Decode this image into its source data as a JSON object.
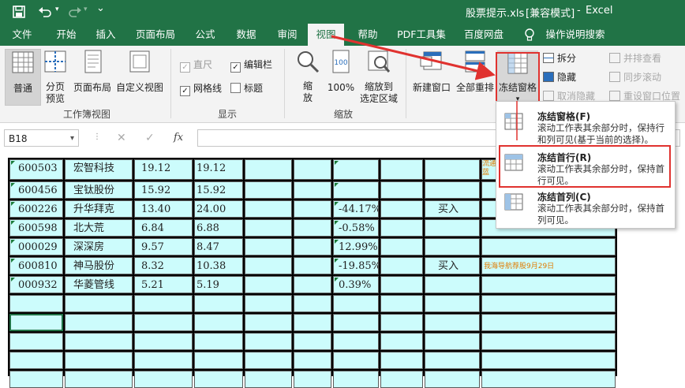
{
  "titlebar": {
    "filename": "股票提示.xls",
    "mode": "[兼容模式]",
    "separator": "-",
    "app": "Excel"
  },
  "tabs": [
    "文件",
    "开始",
    "插入",
    "页面布局",
    "公式",
    "数据",
    "审阅",
    "视图",
    "帮助",
    "PDF工具集",
    "百度网盘",
    "操作说明搜索"
  ],
  "active_tab": "视图",
  "ribbon": {
    "workbook_views": {
      "normal": "普通",
      "page_break": "分页\n预览",
      "page_layout": "页面布局",
      "custom": "自定义视图",
      "group": "工作簿视图"
    },
    "show": {
      "ruler": "直尺",
      "formula_bar": "编辑栏",
      "gridlines": "网格线",
      "headings": "标题",
      "group": "显示"
    },
    "zoom": {
      "zoom": "缩\n放",
      "zoom100": "100%",
      "zoom_sel": "缩放到\n选定区域",
      "group": "缩放"
    },
    "window": {
      "new_window": "新建窗口",
      "arrange_all": "全部重排",
      "freeze": "冻结窗格",
      "split": "拆分",
      "hide": "隐藏",
      "unhide": "取消隐藏",
      "side_by_side": "并排查看",
      "sync_scroll": "同步滚动",
      "reset_pos": "重设窗口位置"
    }
  },
  "namebox": "B18",
  "formula_icons": {
    "cancel": "✕",
    "enter": "✓",
    "fx": "fx"
  },
  "freeze_menu": [
    {
      "title": "冻结窗格(F)",
      "desc": "滚动工作表其余部分时，保持行和列可见(基于当前的选择)。"
    },
    {
      "title": "冻结首行(R)",
      "desc": "滚动工作表其余部分时，保持首行可见。"
    },
    {
      "title": "冻结首列(C)",
      "desc": "滚动工作表其余部分时，保持首列可见。"
    }
  ],
  "rows": [
    {
      "code": "600503",
      "name": "宏智科技",
      "a": "19.12",
      "b": "19.12",
      "pct": "",
      "act": "",
      "note": "流通",
      "note2": "蓝"
    },
    {
      "code": "600456",
      "name": "宝钛股份",
      "a": "15.92",
      "b": "15.92",
      "pct": "",
      "act": "",
      "note": ""
    },
    {
      "code": "600226",
      "name": "升华拜克",
      "a": "13.40",
      "b": "24.00",
      "pct": "-44.17%",
      "act": "买入",
      "note": ""
    },
    {
      "code": "600598",
      "name": "北大荒",
      "a": "6.84",
      "b": "6.88",
      "pct": "-0.58%",
      "act": "",
      "note": ""
    },
    {
      "code": "000029",
      "name": "深深房",
      "a": "9.57",
      "b": "8.47",
      "pct": "12.99%",
      "act": "",
      "note": ""
    },
    {
      "code": "600810",
      "name": "神马股份",
      "a": "8.32",
      "b": "10.38",
      "pct": "-19.85%",
      "act": "买入",
      "note": "我海导航荐股9月29日"
    },
    {
      "code": "000932",
      "name": "华菱管线",
      "a": "5.21",
      "b": "5.19",
      "pct": "0.39%",
      "act": "",
      "note": ""
    }
  ],
  "colors": {
    "excel_green": "#217346",
    "cell_cyan": "#ccfcfc",
    "highlight_red": "#e0322f",
    "note_orange": "#e07b00"
  }
}
